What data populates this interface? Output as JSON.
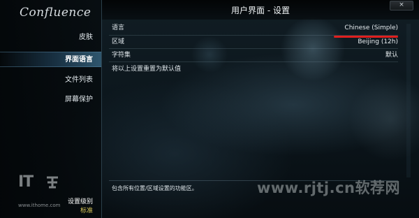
{
  "app": {
    "logo": "Confluence"
  },
  "header": {
    "title": "用户界面 - 设置",
    "close_label": "×"
  },
  "sidebar": {
    "items": [
      {
        "label": "皮肤"
      },
      {
        "label": "界面语言"
      },
      {
        "label": "文件列表"
      },
      {
        "label": "屏幕保护"
      }
    ],
    "active_index": 1,
    "level_label": "设置级别",
    "level_value": "标准"
  },
  "settings": [
    {
      "label": "语言",
      "value": "Chinese (Simple)"
    },
    {
      "label": "区域",
      "value": "Beijing (12h)"
    },
    {
      "label": "字符集",
      "value": "默认"
    },
    {
      "label": "将以上设置重置为默认值",
      "value": ""
    }
  ],
  "hint": "包含所有位置/区域设置的功能区。",
  "watermarks": {
    "it": "IT",
    "site_url": "www.ithome.com",
    "overlay": "www.rjtj.cn软荐网"
  },
  "colors": {
    "accent_underline": "#e0201f",
    "level_value": "#d8c65a"
  }
}
